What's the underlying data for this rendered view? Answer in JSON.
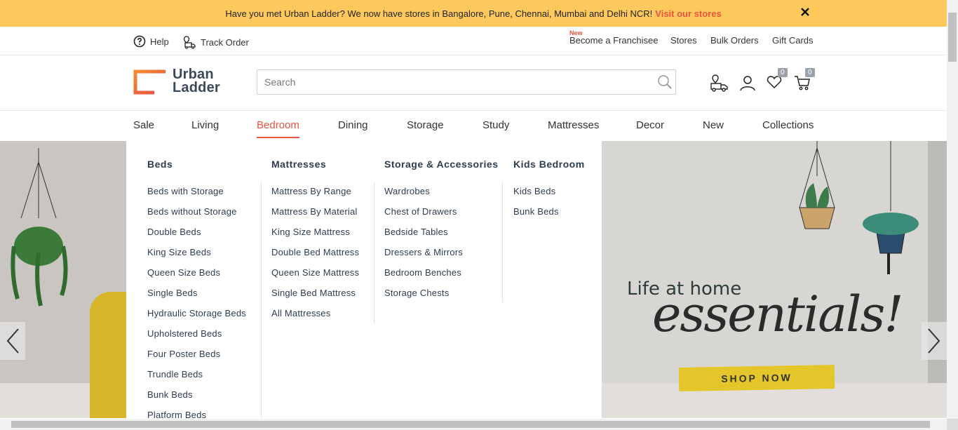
{
  "announcement": {
    "text": "Have you met Urban Ladder? We now have stores in Bangalore, Pune, Chennai, Mumbai and Delhi NCR!",
    "link": "Visit our stores",
    "close_icon": "close-icon"
  },
  "utility": {
    "help": "Help",
    "track_order": "Track Order",
    "new_badge": "New",
    "franchise": "Become a Franchisee",
    "stores": "Stores",
    "bulk_orders": "Bulk Orders",
    "gift_cards": "Gift Cards"
  },
  "header": {
    "logo_line1": "Urban",
    "logo_line2": "Ladder",
    "search_placeholder": "Search",
    "wishlist_count": "0",
    "cart_count": "0"
  },
  "nav": {
    "tabs": [
      "Sale",
      "Living",
      "Bedroom",
      "Dining",
      "Storage",
      "Study",
      "Mattresses",
      "Decor",
      "New",
      "Collections"
    ],
    "active": "Bedroom"
  },
  "mega_menu": {
    "columns": [
      {
        "title": "Beds",
        "items": [
          "Beds with Storage",
          "Beds without Storage",
          "Double Beds",
          "King Size Beds",
          "Queen Size Beds",
          "Single Beds",
          "Hydraulic Storage Beds",
          "Upholstered Beds",
          "Four Poster Beds",
          "Trundle Beds",
          "Bunk Beds",
          "Platform Beds"
        ]
      },
      {
        "title": "Mattresses",
        "items": [
          "Mattress By Range",
          "Mattress By Material",
          "King Size Mattress",
          "Double Bed Mattress",
          "Queen Size Mattress",
          "Single Bed Mattress",
          "All Mattresses"
        ]
      },
      {
        "title": "Storage & Accessories",
        "items": [
          "Wardrobes",
          "Chest of Drawers",
          "Bedside Tables",
          "Dressers & Mirrors",
          "Bedroom Benches",
          "Storage Chests"
        ]
      },
      {
        "title": "Kids Bedroom",
        "items": [
          "Kids Beds",
          "Bunk Beds"
        ]
      }
    ]
  },
  "banner": {
    "line1": "Life at home",
    "line2": "essentials!",
    "cta": "SHOP NOW"
  },
  "colors": {
    "accent": "#e6533f",
    "announcement_bg": "#fdc95d",
    "menu_text": "#2c3d4f"
  }
}
